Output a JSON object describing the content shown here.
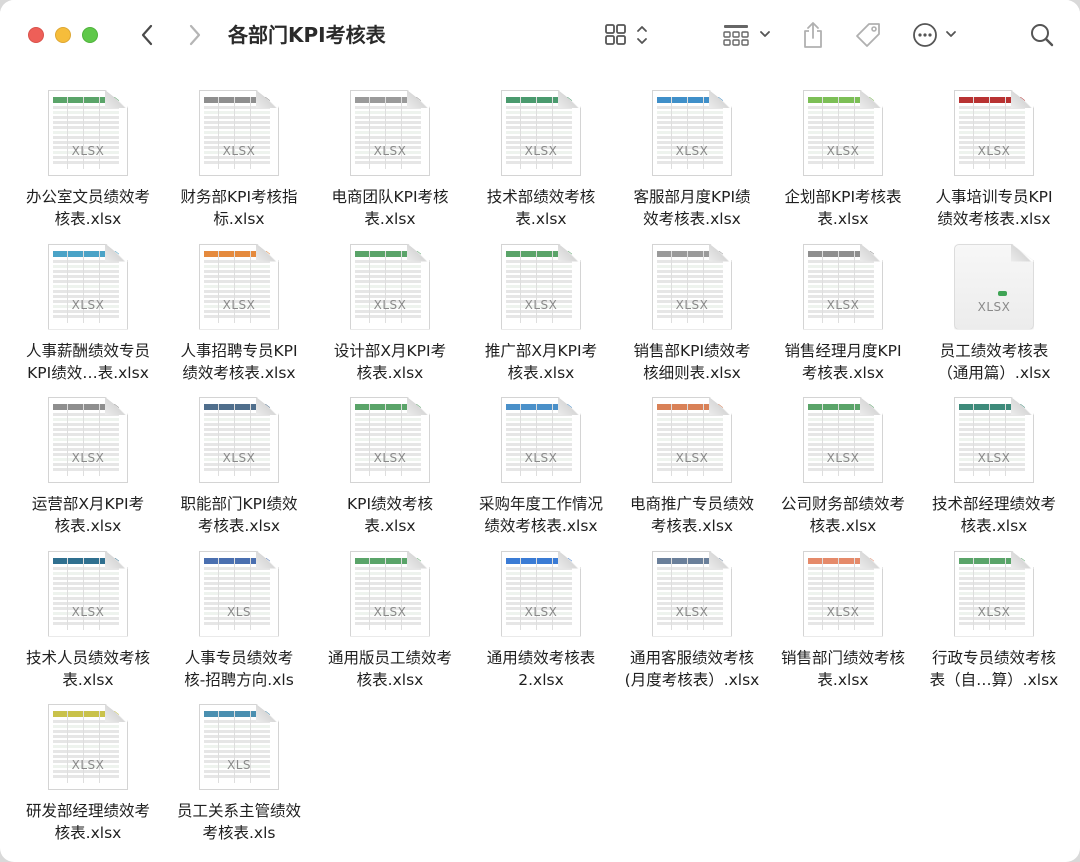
{
  "window": {
    "title": "各部门KPI考核表"
  },
  "toolbar": {
    "back_icon": "chevron-left-icon",
    "forward_icon": "chevron-right-icon",
    "view_icon": "grid-view-icon",
    "group_icon": "group-by-icon",
    "share_icon": "share-icon",
    "tag_icon": "tag-icon",
    "more_icon": "ellipsis-circle-icon",
    "search_icon": "search-icon"
  },
  "colors": {
    "close": "#ee5f58",
    "minimize": "#f6bd3b",
    "zoom": "#5fc84a"
  },
  "files": [
    {
      "line1": "办公室文员绩效考",
      "line2": "核表.xlsx",
      "ext": "XLSX",
      "accent": "#5aa469"
    },
    {
      "line1": "财务部KPI考核指",
      "line2": "标.xlsx",
      "ext": "XLSX",
      "accent": "#8e8e8e"
    },
    {
      "line1": "电商团队KPI考核",
      "line2": "表.xlsx",
      "ext": "XLSX",
      "accent": "#9a9a9a"
    },
    {
      "line1": "技术部绩效考核",
      "line2": "表.xlsx",
      "ext": "XLSX",
      "accent": "#4a9a6e"
    },
    {
      "line1": "客服部月度KPI绩",
      "line2": "效考核表.xlsx",
      "ext": "XLSX",
      "accent": "#3f8fc9"
    },
    {
      "line1": "企划部KPI考核表",
      "line2": "表.xlsx",
      "ext": "XLSX",
      "accent": "#7cbf56"
    },
    {
      "line1": "人事培训专员KPI",
      "line2": "绩效考核表.xlsx",
      "ext": "XLSX",
      "accent": "#b83232"
    },
    {
      "line1": "人事薪酬绩效专员",
      "line2": "KPI绩效…表.xlsx",
      "ext": "XLSX",
      "accent": "#4aa3c7"
    },
    {
      "line1": "人事招聘专员KPI",
      "line2": "绩效考核表.xlsx",
      "ext": "XLSX",
      "accent": "#e58a3d"
    },
    {
      "line1": "设计部X月KPI考",
      "line2": "核表.xlsx",
      "ext": "XLSX",
      "accent": "#5aa469"
    },
    {
      "line1": "推广部X月KPI考",
      "line2": "核表.xlsx",
      "ext": "XLSX",
      "accent": "#5aa469"
    },
    {
      "line1": "销售部KPI绩效考",
      "line2": "核细则表.xlsx",
      "ext": "XLSX",
      "accent": "#9a9a9a"
    },
    {
      "line1": "销售经理月度KPI",
      "line2": "考核表.xlsx",
      "ext": "XLSX",
      "accent": "#8e8e8e"
    },
    {
      "line1": "员工绩效考核表",
      "line2": "（通用篇）.xlsx",
      "ext": "XLSX",
      "accent": "#3fa455"
    },
    {
      "line1": "运营部X月KPI考",
      "line2": "核表.xlsx",
      "ext": "XLSX",
      "accent": "#8e8e8e"
    },
    {
      "line1": "职能部门KPI绩效",
      "line2": "考核表.xlsx",
      "ext": "XLSX",
      "accent": "#4f6e8c"
    },
    {
      "line1": "KPI绩效考核",
      "line2": "表.xlsx",
      "ext": "XLSX",
      "accent": "#5aa469"
    },
    {
      "line1": "采购年度工作情况",
      "line2": "绩效考核表.xlsx",
      "ext": "XLSX",
      "accent": "#4a90c9"
    },
    {
      "line1": "电商推广专员绩效",
      "line2": "考核表.xlsx",
      "ext": "XLSX",
      "accent": "#d98157"
    },
    {
      "line1": "公司财务部绩效考",
      "line2": "核表.xlsx",
      "ext": "XLSX",
      "accent": "#5aa469"
    },
    {
      "line1": "技术部经理绩效考",
      "line2": "核表.xlsx",
      "ext": "XLSX",
      "accent": "#3d8a7a"
    },
    {
      "line1": "技术人员绩效考核",
      "line2": "表.xlsx",
      "ext": "XLSX",
      "accent": "#2f6f8f"
    },
    {
      "line1": "人事专员绩效考",
      "line2": "核-招聘方向.xls",
      "ext": "XLS",
      "accent": "#4a6fb0"
    },
    {
      "line1": "通用版员工绩效考",
      "line2": "核表.xlsx",
      "ext": "XLSX",
      "accent": "#5aa469"
    },
    {
      "line1": "通用绩效考核表",
      "line2": "2.xlsx",
      "ext": "XLSX",
      "accent": "#3a7bd5"
    },
    {
      "line1": "通用客服绩效考核",
      "line2": "(月度考核表）.xlsx",
      "ext": "XLSX",
      "accent": "#6a7f9a"
    },
    {
      "line1": "销售部门绩效考核",
      "line2": "表.xlsx",
      "ext": "XLSX",
      "accent": "#e58a6a"
    },
    {
      "line1": "行政专员绩效考核",
      "line2": "表（自…算）.xlsx",
      "ext": "XLSX",
      "accent": "#5aa469"
    },
    {
      "line1": "研发部经理绩效考",
      "line2": "核表.xlsx",
      "ext": "XLSX",
      "accent": "#c9c24a"
    },
    {
      "line1": "员工关系主管绩效",
      "line2": "考核表.xls",
      "ext": "XLS",
      "accent": "#4a8fb0"
    }
  ]
}
